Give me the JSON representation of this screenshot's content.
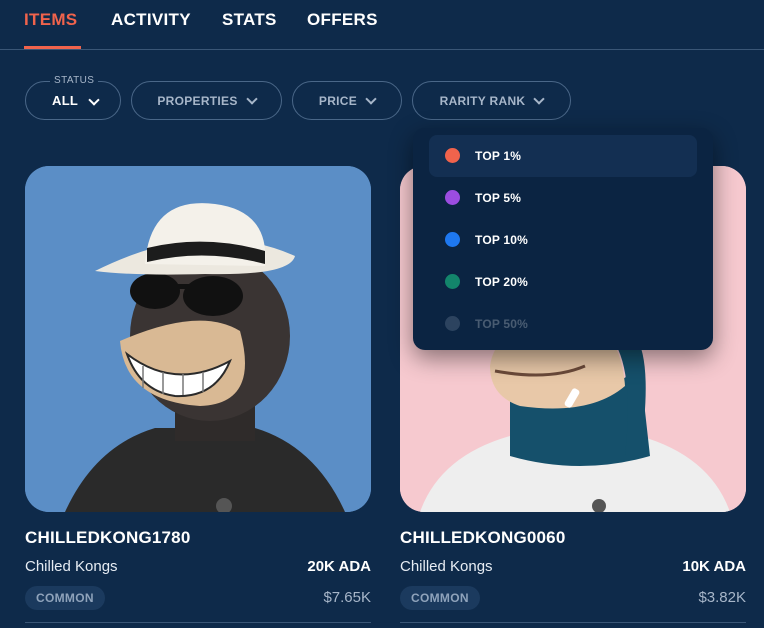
{
  "tabs": [
    {
      "label": "ITEMS",
      "active": true
    },
    {
      "label": "ACTIVITY",
      "active": false
    },
    {
      "label": "STATS",
      "active": false
    },
    {
      "label": "OFFERS",
      "active": false
    }
  ],
  "filters": {
    "status": {
      "label": "STATUS",
      "value": "ALL"
    },
    "properties": "PROPERTIES",
    "price": "PRICE",
    "rarity_rank": "RARITY RANK"
  },
  "rarity_dropdown": {
    "items": [
      {
        "label": "TOP 1%",
        "color": "#f0634c"
      },
      {
        "label": "TOP 5%",
        "color": "#9b4de0"
      },
      {
        "label": "TOP 10%",
        "color": "#1e78f0"
      },
      {
        "label": "TOP 20%",
        "color": "#13856b"
      },
      {
        "label": "TOP 50%",
        "color": "#8ea0b5"
      }
    ]
  },
  "cards": [
    {
      "name": "CHILLEDKONG1780",
      "collection": "Chilled Kongs",
      "price": "20K ADA",
      "rarity": "COMMON",
      "usd": "$7.65K",
      "bg": "#5b8ec6"
    },
    {
      "name": "CHILLEDKONG0060",
      "collection": "Chilled Kongs",
      "price": "10K ADA",
      "rarity": "COMMON",
      "usd": "$3.82K",
      "bg": "#f6c9cf"
    }
  ],
  "colors": {
    "accent": "#f0634c",
    "background": "#0e2a4a"
  }
}
